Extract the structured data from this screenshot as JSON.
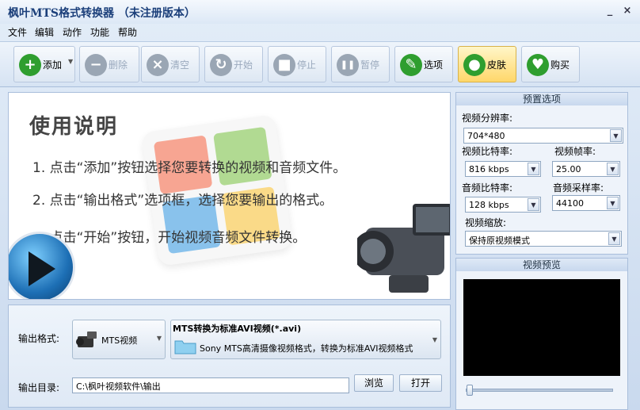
{
  "window": {
    "title": "枫叶MTS格式转换器 （未注册版本）",
    "minimize": "_",
    "close": "×"
  },
  "menu": [
    "文件",
    "编辑",
    "动作",
    "功能",
    "帮助"
  ],
  "toolbar": [
    {
      "label": "添加",
      "icon": "plus-icon",
      "color": "#2f9e2f",
      "glyph": "+",
      "enabled": true
    },
    {
      "label": "删除",
      "icon": "minus-icon",
      "color": "#9aa6b4",
      "glyph": "−",
      "enabled": false
    },
    {
      "label": "清空",
      "icon": "clear-icon",
      "color": "#9aa6b4",
      "glyph": "×",
      "enabled": false
    },
    {
      "label": "开始",
      "icon": "refresh-icon",
      "color": "#9aa6b4",
      "glyph": "↻",
      "enabled": false
    },
    {
      "label": "停止",
      "icon": "stop-icon",
      "color": "#9aa6b4",
      "glyph": "■",
      "enabled": false
    },
    {
      "label": "暂停",
      "icon": "pause-icon",
      "color": "#9aa6b4",
      "glyph": "❚❚",
      "enabled": false
    },
    {
      "label": "选项",
      "icon": "tools-icon",
      "color": "#2f9e2f",
      "glyph": "✎",
      "enabled": true
    },
    {
      "label": "皮肤",
      "icon": "apple-icon",
      "color": "#2f9e2f",
      "glyph": "●",
      "enabled": true
    },
    {
      "label": "购买",
      "icon": "cart-icon",
      "color": "#2f9e2f",
      "glyph": "♥",
      "enabled": true
    }
  ],
  "instructions": {
    "title": "使用说明",
    "steps": [
      "1. 点击“添加”按钮选择您要转换的视频和音频文件。",
      "2. 点击“输出格式”选项框，选择您要输出的格式。",
      "3. 点击“开始”按钮，开始视频音频文件转换。"
    ]
  },
  "output": {
    "format_label": "输出格式:",
    "format_value": "MTS视频",
    "desc_title": "MTS转换为标准AVI视频(*.avi)",
    "desc_text": "Sony MTS高清摄像视频格式，转换为标准AVI视频格式",
    "dir_label": "输出目录:",
    "dir_value": "C:\\枫叶视频软件\\输出",
    "browse": "浏览",
    "open": "打开"
  },
  "presets": {
    "title": "预置选项",
    "resolution_label": "视频分辨率:",
    "resolution": "704*480",
    "video_bitrate_label": "视频比特率:",
    "video_bitrate": "816 kbps",
    "framerate_label": "视频帧率:",
    "framerate": "25.00",
    "audio_bitrate_label": "音频比特率:",
    "audio_bitrate": "128 kbps",
    "samplerate_label": "音频采样率:",
    "samplerate": "44100",
    "scale_label": "视频缩放:",
    "scale": "保持原视频模式"
  },
  "preview": {
    "title": "视频预览",
    "position": 0
  }
}
